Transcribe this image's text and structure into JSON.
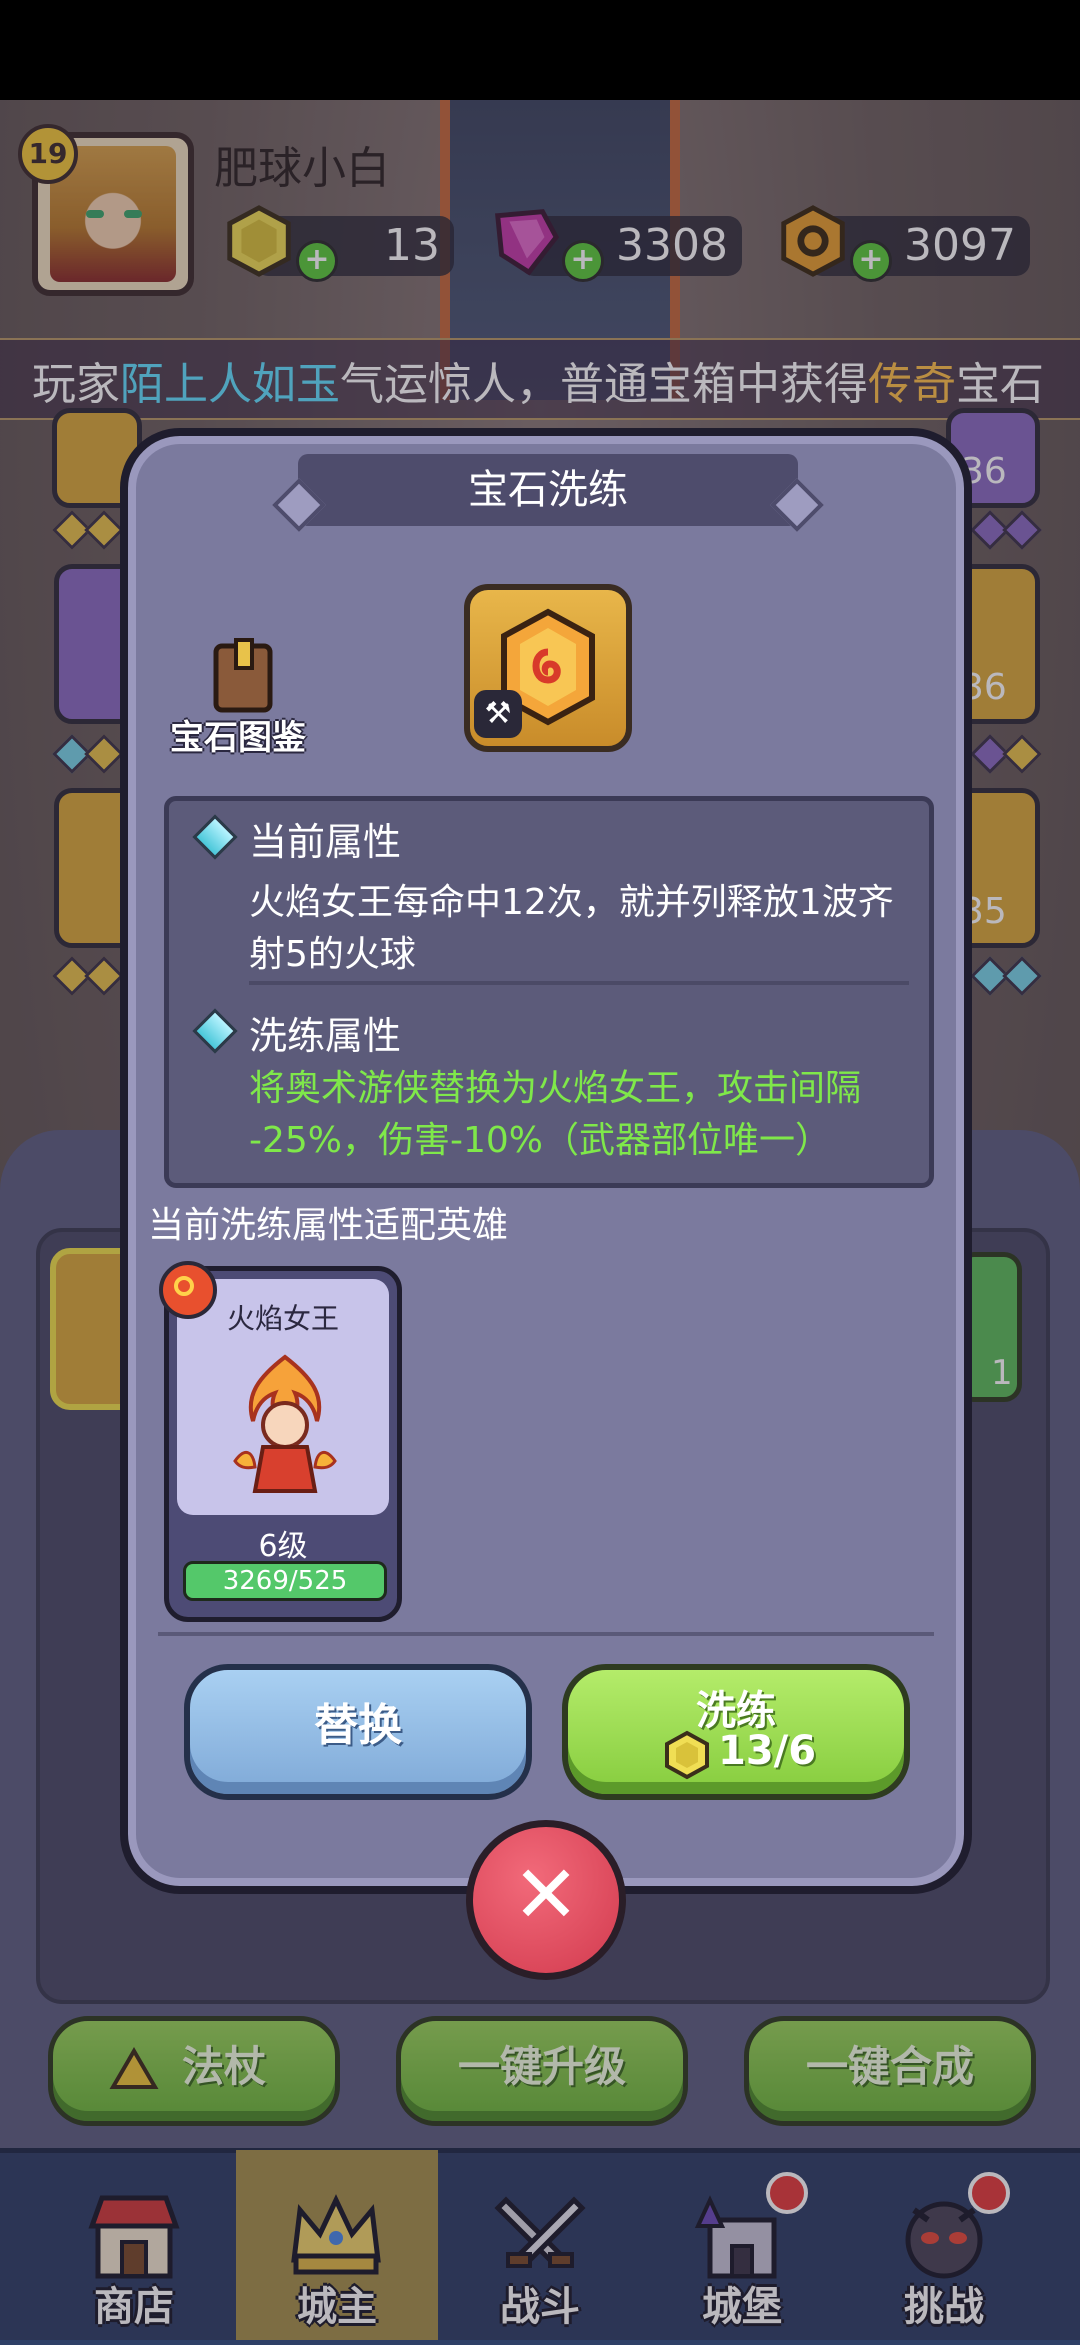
{
  "player": {
    "level": "19",
    "name": "肥球小白"
  },
  "currencies": [
    {
      "name": "gold-gem",
      "value": "13",
      "color": "#e8d84a"
    },
    {
      "name": "purple-crystal",
      "value": "3308",
      "color": "#c43aa8"
    },
    {
      "name": "gold-coin",
      "value": "3097",
      "color": "#e8a030"
    }
  ],
  "banner": {
    "prefix": "玩家",
    "player": "陌上人如玉",
    "middle": "气运惊人，普通宝箱中获得",
    "rarity": "传奇",
    "suffix": "宝石"
  },
  "background_tiles": {
    "right_numbers": [
      "36",
      "36",
      "35"
    ],
    "right_badge": "1"
  },
  "dialog": {
    "title": "宝石洗练",
    "atlas_label": "宝石图鉴",
    "current_attr": {
      "heading": "当前属性",
      "lines": [
        "火焰女王每命中12次，就并列释放1波齐",
        "射5的火球"
      ]
    },
    "refine_attr": {
      "heading": "洗练属性",
      "lines": [
        "将奥术游侠替换为火焰女王，攻击间隔",
        "-25%，伤害-10%（武器部位唯一）"
      ]
    },
    "heroes_caption": "当前洗练属性适配英雄",
    "hero": {
      "name": "火焰女王",
      "level": "6级",
      "exp": "3269/525",
      "exp_fraction": 1.0
    },
    "replace_label": "替换",
    "refine_label": "洗练",
    "refine_cost": "13/6"
  },
  "actions": [
    "法杖",
    "一键升级",
    "一键合成"
  ],
  "nav": [
    {
      "label": "商店",
      "icon": "shop-icon",
      "active": false
    },
    {
      "label": "城主",
      "icon": "crown-icon",
      "active": true
    },
    {
      "label": "战斗",
      "icon": "swords-icon",
      "active": false
    },
    {
      "label": "城堡",
      "icon": "castle-icon",
      "active": false
    },
    {
      "label": "挑战",
      "icon": "challenge-icon",
      "active": false
    }
  ],
  "colors": {
    "accent_green": "#7fe84a",
    "highlight_cyan": "#63e1ff",
    "highlight_gold": "#ffc24a",
    "nav_active": "#a6914c"
  }
}
